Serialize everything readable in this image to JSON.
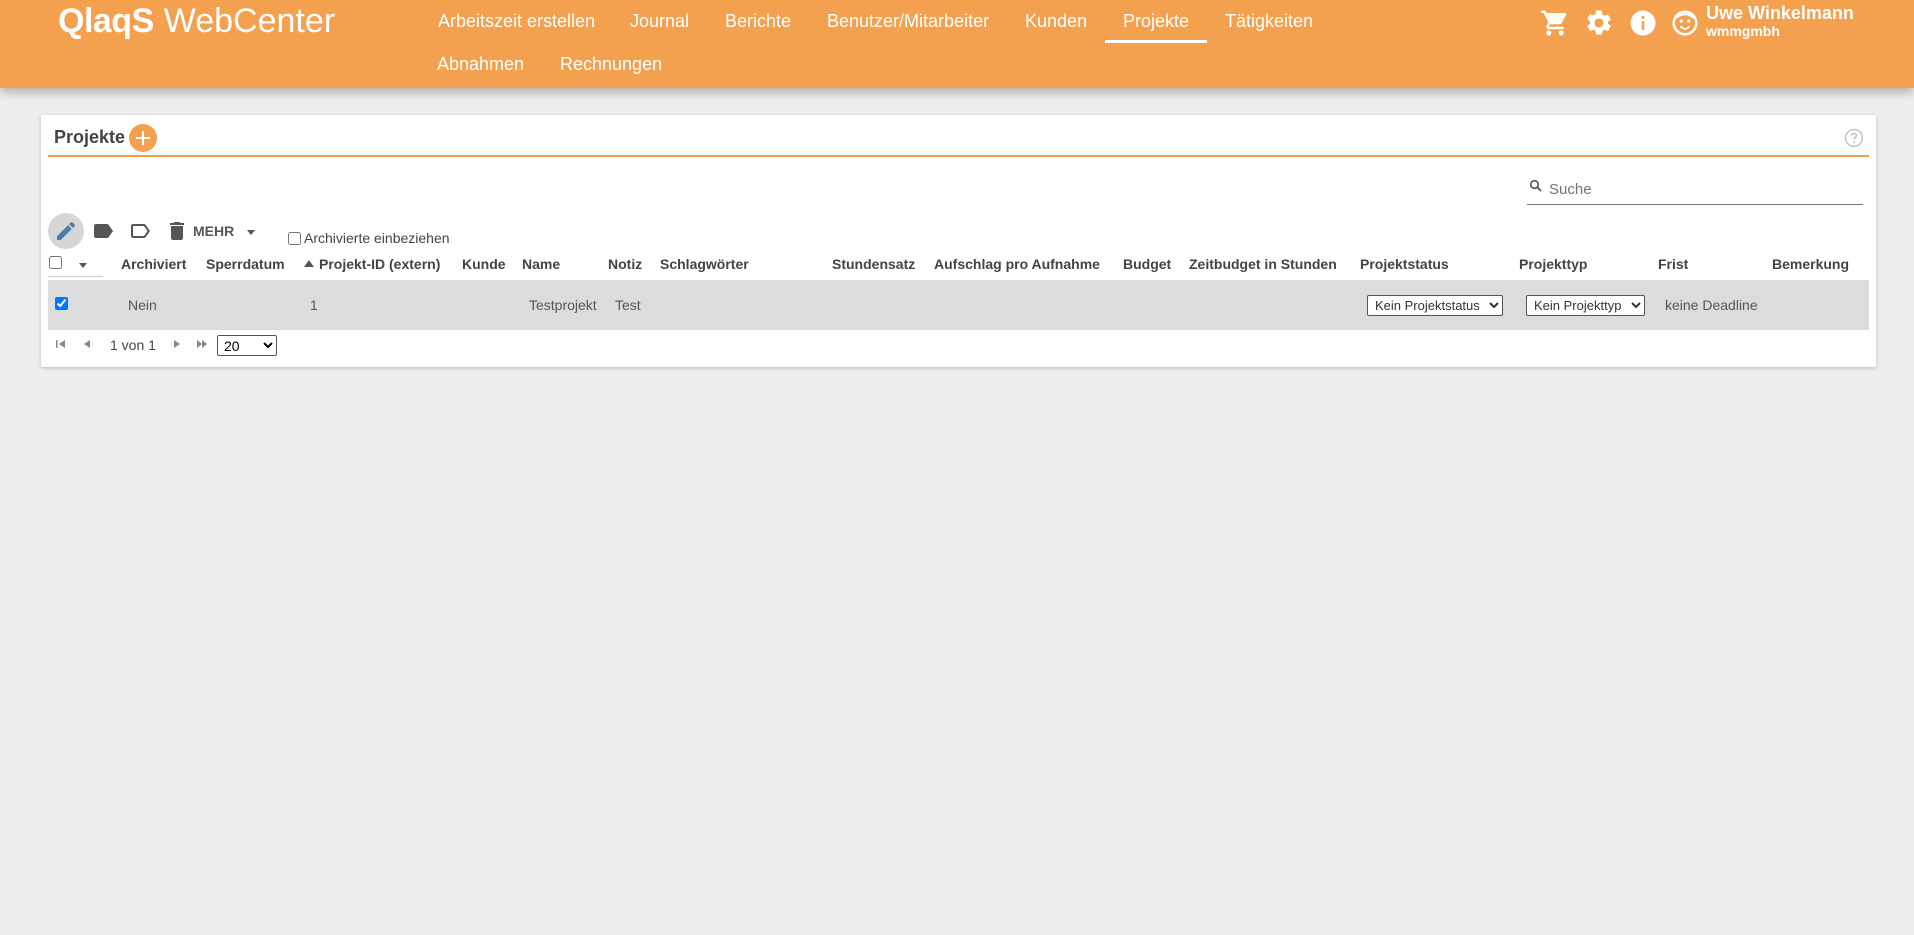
{
  "app": {
    "brand": "QlaqS",
    "product": "WebCenter"
  },
  "nav": [
    {
      "label": "Arbeitszeit erstellen",
      "active": false
    },
    {
      "label": "Journal",
      "active": false
    },
    {
      "label": "Berichte",
      "active": false
    },
    {
      "label": "Benutzer/Mitarbeiter",
      "active": false
    },
    {
      "label": "Kunden",
      "active": false
    },
    {
      "label": "Projekte",
      "active": true
    },
    {
      "label": "Tätigkeiten",
      "active": false
    },
    {
      "label": "Abnahmen",
      "active": false
    },
    {
      "label": "Rechnungen",
      "active": false
    }
  ],
  "header_icons": [
    "cart-icon",
    "gear-icon",
    "info-icon",
    "user-face-icon"
  ],
  "user": {
    "name": "Uwe Winkelmann",
    "org": "wmmgmbh"
  },
  "card": {
    "title": "Projekte"
  },
  "search": {
    "placeholder": "Suche",
    "value": ""
  },
  "toolbar": {
    "icons": [
      "edit-pencil-icon",
      "tag-filled-icon",
      "tag-outline-icon",
      "trash-icon"
    ],
    "more_label": "MEHR",
    "include_archived_label": "Archivierte einbeziehen",
    "include_archived_checked": false
  },
  "table": {
    "columns": [
      "Archiviert",
      "Sperrdatum",
      "Projekt-ID (extern)",
      "Kunde",
      "Name",
      "Notiz",
      "Schlagwörter",
      "Stundensatz",
      "Aufschlag pro Aufnahme",
      "Budget",
      "Zeitbudget in Stunden",
      "Projektstatus",
      "Projekttyp",
      "Frist",
      "Bemerkung"
    ],
    "sorted_column": "Projekt-ID (extern)",
    "sort_direction": "ascending",
    "rows": [
      {
        "selected": true,
        "archiviert": "Nein",
        "sperrdatum": "",
        "projekt_id": "1",
        "kunde": "",
        "name": "Testprojekt",
        "notiz": "Test",
        "schlagwoerter": "",
        "stundensatz": "",
        "aufschlag": "",
        "budget": "",
        "zeitbudget": "",
        "projektstatus": "Kein Projektstatus",
        "projekttyp": "Kein Projekttyp",
        "frist": "keine Deadline",
        "bemerkung": ""
      }
    ]
  },
  "pagination": {
    "text": "1 von 1",
    "page_size": "20"
  },
  "colors": {
    "accent": "#f4a14f",
    "row_selected": "#dcdcdc",
    "background": "#eeeeee"
  }
}
